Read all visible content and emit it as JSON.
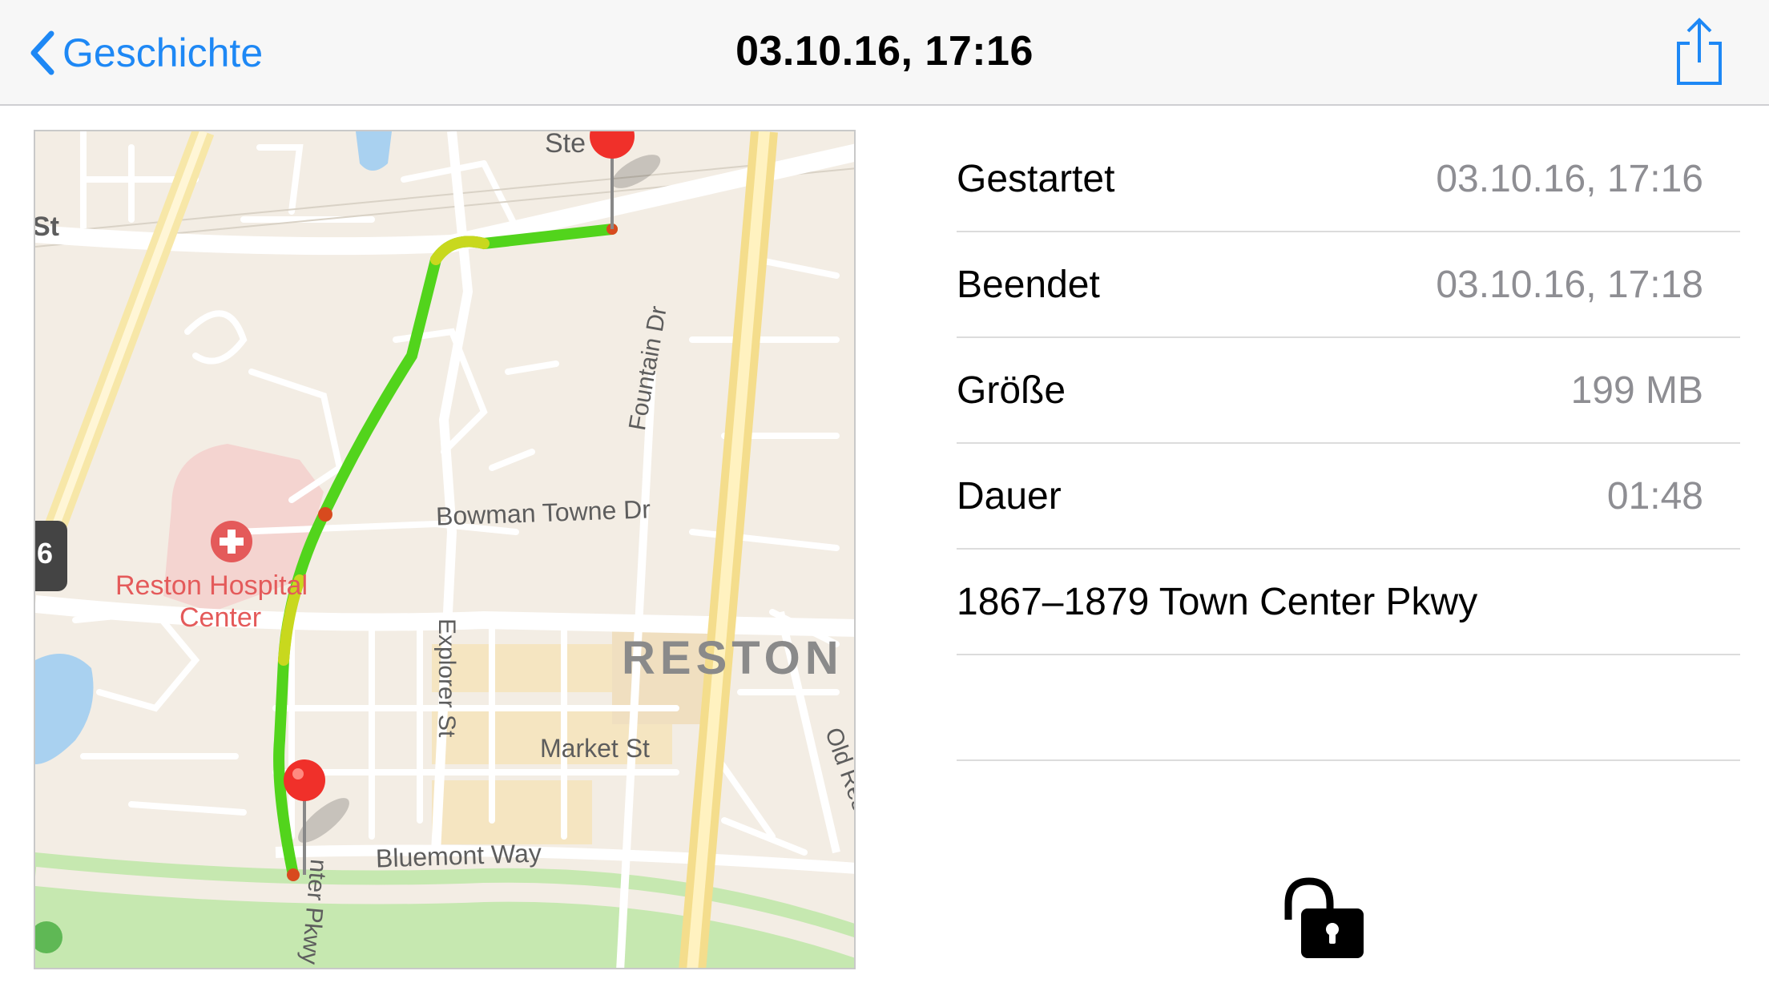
{
  "nav": {
    "back_label": "Geschichte",
    "title": "03.10.16, 17:16",
    "share_icon": "share-icon"
  },
  "map": {
    "labels": {
      "top_street": "Ste",
      "left_street": "St",
      "fountain": "Fountain Dr",
      "bowman": "Bowman Towne Dr",
      "hospital_line1": "Reston Hospital",
      "hospital_line2": "Center",
      "explorer": "Explorer St",
      "reston": "RESTON",
      "market": "Market St",
      "old_reston": "Old Resto",
      "bluemont": "Bluemont Way",
      "parkway": "nter Pkwy",
      "route_shield": "6"
    },
    "colors": {
      "route_fast": "#52d41c",
      "route_mid": "#c8d81e",
      "route_slow": "#d84a1e",
      "pin": "#f0302a",
      "hospital": "#e45a5a"
    }
  },
  "details": {
    "rows": [
      {
        "label": "Gestartet",
        "value": "03.10.16, 17:16"
      },
      {
        "label": "Beendet",
        "value": "03.10.16, 17:18"
      },
      {
        "label": "Größe",
        "value": "199 MB"
      },
      {
        "label": "Dauer",
        "value": "01:48"
      },
      {
        "label": "1867–1879 Town Center Pkwy",
        "value": ""
      },
      {
        "label": "",
        "value": ""
      }
    ],
    "lock_icon": "unlock-icon"
  }
}
